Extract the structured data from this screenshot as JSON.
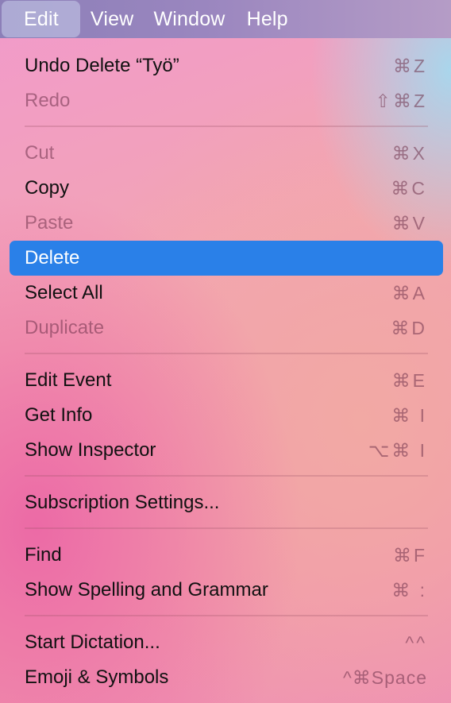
{
  "menubar": {
    "items": [
      {
        "label": "Edit"
      },
      {
        "label": "View"
      },
      {
        "label": "Window"
      },
      {
        "label": "Help"
      }
    ]
  },
  "menu": {
    "items": [
      {
        "label": "Undo Delete “Työ”",
        "shortcut": "⌘Z"
      },
      {
        "label": "Redo",
        "shortcut": "⇧⌘Z"
      },
      {
        "label": "Cut",
        "shortcut": "⌘X"
      },
      {
        "label": "Copy",
        "shortcut": "⌘C"
      },
      {
        "label": "Paste",
        "shortcut": "⌘V"
      },
      {
        "label": "Delete",
        "shortcut": ""
      },
      {
        "label": "Select All",
        "shortcut": "⌘A"
      },
      {
        "label": "Duplicate",
        "shortcut": "⌘D"
      },
      {
        "label": "Edit Event",
        "shortcut": "⌘E"
      },
      {
        "label": "Get Info",
        "shortcut": "⌘ I"
      },
      {
        "label": "Show Inspector",
        "shortcut": "⌥⌘ I"
      },
      {
        "label": "Subscription Settings...",
        "shortcut": ""
      },
      {
        "label": "Find",
        "shortcut": "⌘F"
      },
      {
        "label": "Show Spelling and Grammar",
        "shortcut": "⌘ :"
      },
      {
        "label": "Start Dictation...",
        "shortcut": "^^"
      },
      {
        "label": "Emoji & Symbols",
        "shortcut": "^⌘Space"
      }
    ]
  },
  "colors": {
    "selection": "#2a80e8",
    "disabled_text": "#9c5a74"
  }
}
